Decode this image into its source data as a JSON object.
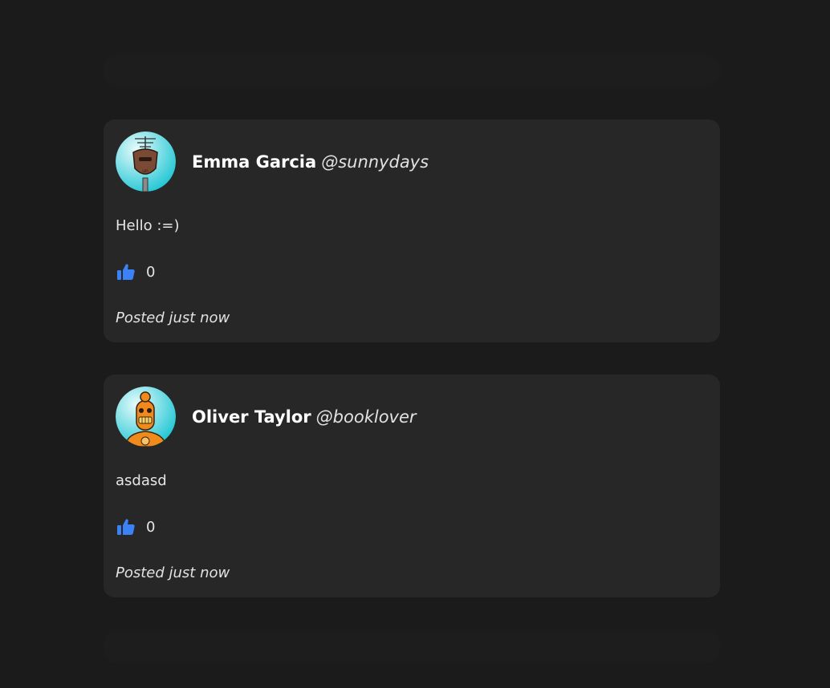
{
  "posts": [
    {
      "author_name": "Emma Garcia",
      "author_handle": "@sunnydays",
      "content": "Hello :=)",
      "likes": "0",
      "timestamp": "Posted just now",
      "avatar_icon": "robot-antenna-avatar-icon"
    },
    {
      "author_name": "Oliver Taylor",
      "author_handle": "@booklover",
      "content": "asdasd",
      "likes": "0",
      "timestamp": "Posted just now",
      "avatar_icon": "robot-orange-avatar-icon"
    }
  ],
  "colors": {
    "background": "#1b1b1b",
    "card": "#272727",
    "like_icon": "#3b82f6",
    "avatar_gradient_start": "#e8fbfb",
    "avatar_gradient_end": "#22c7d4"
  }
}
